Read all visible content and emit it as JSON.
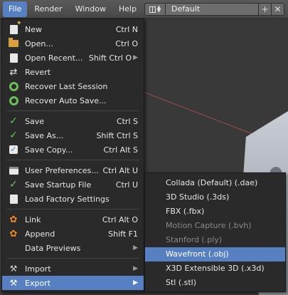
{
  "menubar": {
    "items": [
      "File",
      "Render",
      "Window",
      "Help"
    ],
    "active": "File",
    "layout_name": "Default"
  },
  "file_menu": {
    "items": [
      {
        "label": "New",
        "shortcut": "Ctrl N",
        "icon": "new-file-icon"
      },
      {
        "label": "Open...",
        "shortcut": "Ctrl O",
        "icon": "folder-icon"
      },
      {
        "label": "Open Recent...",
        "shortcut": "Shift Ctrl O",
        "icon": "recent-icon",
        "submenu": true
      },
      {
        "label": "Revert",
        "shortcut": "",
        "icon": "revert-icon"
      },
      {
        "label": "Recover Last Session",
        "shortcut": "",
        "icon": "recover-icon"
      },
      {
        "label": "Recover Auto Save...",
        "shortcut": "",
        "icon": "recover-auto-icon"
      },
      {
        "label": "Save",
        "shortcut": "Ctrl S",
        "icon": "checkmark-icon"
      },
      {
        "label": "Save As...",
        "shortcut": "Shift Ctrl S",
        "icon": "checkmark-icon"
      },
      {
        "label": "Save Copy...",
        "shortcut": "Ctrl Alt S",
        "icon": "checkbox-icon"
      },
      {
        "label": "User Preferences...",
        "shortcut": "Ctrl Alt U",
        "icon": "preferences-icon"
      },
      {
        "label": "Save Startup File",
        "shortcut": "Ctrl U",
        "icon": "checkmark-icon"
      },
      {
        "label": "Load Factory Settings",
        "shortcut": "",
        "icon": "factory-icon"
      },
      {
        "label": "Link",
        "shortcut": "Ctrl Alt O",
        "icon": "link-blend-icon"
      },
      {
        "label": "Append",
        "shortcut": "Shift F1",
        "icon": "append-blend-icon"
      },
      {
        "label": "Data Previews",
        "shortcut": "",
        "icon": "",
        "submenu": true
      },
      {
        "label": "Import",
        "shortcut": "",
        "icon": "import-icon",
        "submenu": true
      },
      {
        "label": "Export",
        "shortcut": "",
        "icon": "export-icon",
        "submenu": true
      }
    ]
  },
  "export_menu": {
    "items": [
      {
        "label": "Collada (Default) (.dae)",
        "enabled": true
      },
      {
        "label": "3D Studio (.3ds)",
        "enabled": true
      },
      {
        "label": "FBX (.fbx)",
        "enabled": true
      },
      {
        "label": "Motion Capture (.bvh)",
        "enabled": false
      },
      {
        "label": "Stanford (.ply)",
        "enabled": false
      },
      {
        "label": "Wavefront (.obj)",
        "enabled": true,
        "highlighted": true
      },
      {
        "label": "X3D Extensible 3D (.x3d)",
        "enabled": true
      },
      {
        "label": "Stl (.stl)",
        "enabled": true
      }
    ]
  },
  "colors": {
    "highlight": "#5680c2",
    "menu_bg": "#2a2a2a",
    "disabled_text": "#8a8a8a"
  }
}
